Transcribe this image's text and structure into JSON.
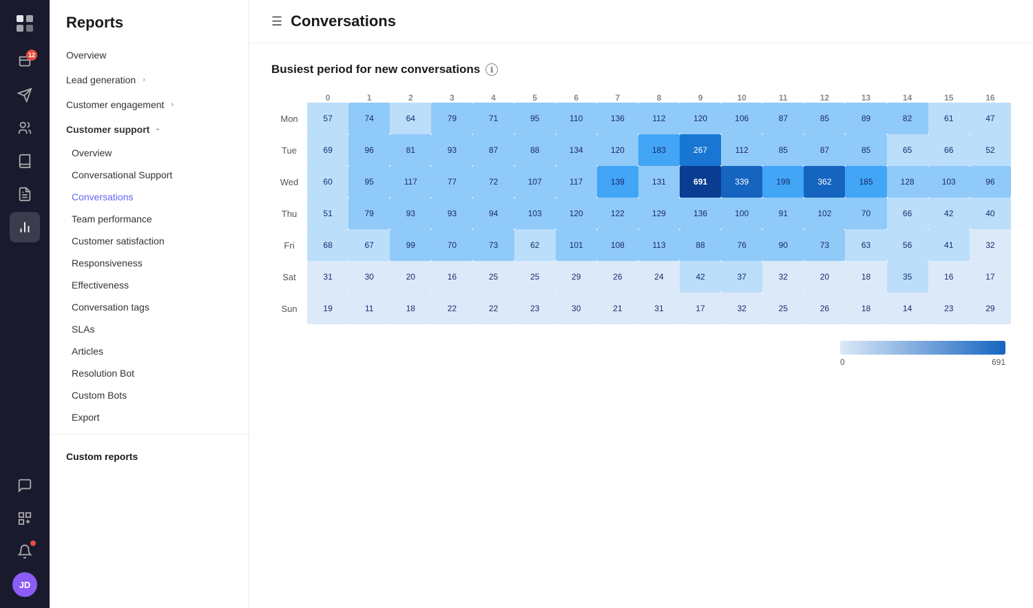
{
  "app": {
    "title": "Reports"
  },
  "icon_bar": {
    "icons": [
      {
        "name": "logo-icon",
        "symbol": "▦",
        "active": false
      },
      {
        "name": "inbox-icon",
        "symbol": "✉",
        "active": false,
        "badge": "12"
      },
      {
        "name": "send-icon",
        "symbol": "➤",
        "active": false
      },
      {
        "name": "team-icon",
        "symbol": "⊕",
        "active": false
      },
      {
        "name": "book-icon",
        "symbol": "📖",
        "active": false
      },
      {
        "name": "compose-icon",
        "symbol": "✏",
        "active": false
      },
      {
        "name": "reports-icon",
        "symbol": "📊",
        "active": true
      },
      {
        "name": "chat-icon",
        "symbol": "💬",
        "active": false
      },
      {
        "name": "apps-icon",
        "symbol": "⊞",
        "active": false
      }
    ]
  },
  "sidebar": {
    "title": "Reports",
    "nav": {
      "overview_label": "Overview",
      "lead_generation_label": "Lead generation",
      "customer_engagement_label": "Customer engagement",
      "customer_support_label": "Customer support",
      "subitems": [
        {
          "label": "Overview",
          "active": false
        },
        {
          "label": "Conversational Support",
          "active": false
        },
        {
          "label": "Conversations",
          "active": true
        },
        {
          "label": "Team performance",
          "active": false
        },
        {
          "label": "Customer satisfaction",
          "active": false
        },
        {
          "label": "Responsiveness",
          "active": false
        },
        {
          "label": "Effectiveness",
          "active": false
        },
        {
          "label": "Conversation tags",
          "active": false
        },
        {
          "label": "SLAs",
          "active": false
        },
        {
          "label": "Articles",
          "active": false
        },
        {
          "label": "Resolution Bot",
          "active": false
        },
        {
          "label": "Custom Bots",
          "active": false
        },
        {
          "label": "Export",
          "active": false
        }
      ]
    },
    "custom_reports_label": "Custom reports"
  },
  "main": {
    "title": "Conversations",
    "section_title": "Busiest period for new conversations",
    "heatmap": {
      "days": [
        "Mon",
        "Tue",
        "Wed",
        "Thu",
        "Fri",
        "Sat",
        "Sun"
      ],
      "hours": [
        "0",
        "1",
        "2",
        "3",
        "4",
        "5",
        "6",
        "7",
        "8",
        "9",
        "10",
        "11",
        "12",
        "13",
        "14",
        "15",
        "16"
      ],
      "values": [
        [
          57,
          74,
          64,
          79,
          71,
          95,
          110,
          136,
          112,
          120,
          106,
          87,
          85,
          89,
          82,
          61,
          47
        ],
        [
          69,
          96,
          81,
          93,
          87,
          88,
          134,
          120,
          183,
          267,
          112,
          85,
          87,
          85,
          65,
          66,
          52
        ],
        [
          60,
          95,
          117,
          77,
          72,
          107,
          117,
          139,
          131,
          691,
          339,
          199,
          362,
          185,
          128,
          103,
          96
        ],
        [
          51,
          79,
          93,
          93,
          94,
          103,
          120,
          122,
          129,
          136,
          100,
          91,
          102,
          70,
          66,
          42,
          40
        ],
        [
          68,
          67,
          99,
          70,
          73,
          62,
          101,
          108,
          113,
          88,
          76,
          90,
          73,
          63,
          56,
          41,
          32
        ],
        [
          31,
          30,
          20,
          16,
          25,
          25,
          29,
          26,
          24,
          42,
          37,
          32,
          20,
          18,
          35,
          16,
          17
        ],
        [
          19,
          11,
          18,
          22,
          22,
          23,
          30,
          21,
          31,
          17,
          32,
          25,
          26,
          18,
          14,
          23,
          29
        ]
      ],
      "max_value": 691,
      "min_value": 0
    },
    "legend": {
      "min_label": "0",
      "max_label": "691"
    }
  }
}
